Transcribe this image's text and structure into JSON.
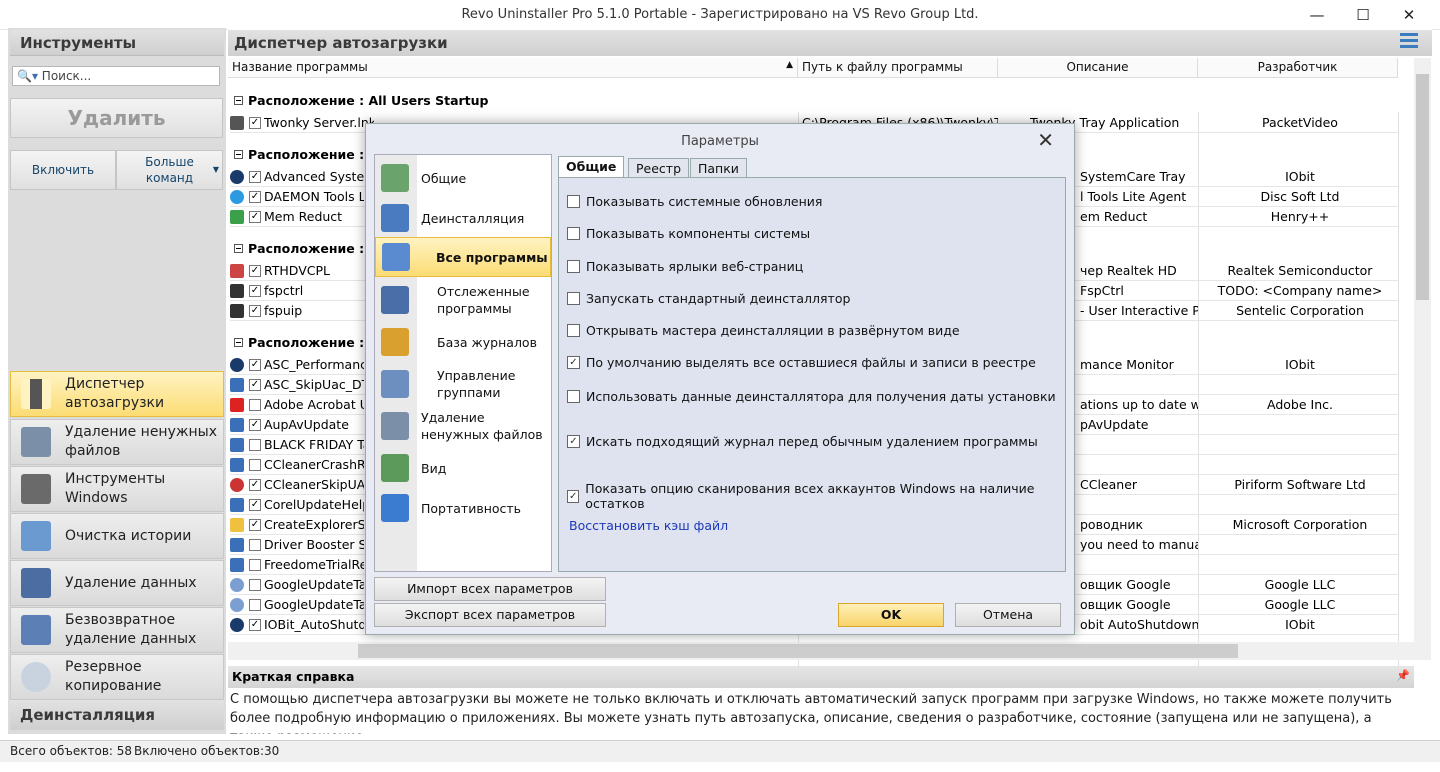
{
  "window": {
    "title": "Revo Uninstaller Pro 5.1.0 Portable - Зарегистрировано на VS Revo Group Ltd."
  },
  "left": {
    "header": "Инструменты",
    "search_placeholder": "Поиск...",
    "delete": "Удалить",
    "enable": "Включить",
    "more": "Больше команд",
    "tools": [
      "Диспетчер автозагрузки",
      "Удаление ненужных файлов",
      "Инструменты Windows",
      "Очистка истории",
      "Удаление данных",
      "Безвозвратное удаление данных",
      "Резервное копирование"
    ],
    "footer": "Деинсталляция"
  },
  "main": {
    "header": "Диспетчер автозагрузки",
    "columns": [
      "Название программы",
      "Путь к файлу программы",
      "Описание",
      "Разработчик"
    ],
    "groups": [
      "Расположение : All Users Startup",
      "Расположение : Re",
      "Расположение : Re",
      "Расположение : За"
    ],
    "group1_rows": [
      {
        "name": "Twonky Server.lnk",
        "path": "C:\\Program Files (x86)\\Twonky\\Tw",
        "desc": "Twonky Tray Application",
        "dev": "PacketVideo",
        "c": "✓"
      }
    ],
    "group2_rows": [
      {
        "name": "Advanced System",
        "desc": "SystemCare Tray",
        "dev": "IObit",
        "c": "✓"
      },
      {
        "name": "DAEMON Tools L",
        "desc": "l Tools Lite Agent",
        "dev": "Disc Soft Ltd",
        "c": "✓"
      },
      {
        "name": "Mem Reduct",
        "desc": "em Reduct",
        "dev": "Henry++",
        "c": "✓"
      }
    ],
    "group3_rows": [
      {
        "name": "RTHDVCPL",
        "desc": "чер Realtek HD",
        "dev": "Realtek Semiconductor",
        "c": "✓"
      },
      {
        "name": "fspctrl",
        "desc": "FspCtrl",
        "dev": "TODO: <Company name>",
        "c": "✓"
      },
      {
        "name": "fspuip",
        "desc": "- User Interactive Pr",
        "dev": "Sentelic Corporation",
        "c": "✓"
      }
    ],
    "group4_rows": [
      {
        "name": "ASC_Performance",
        "desc": "mance Monitor",
        "dev": "IObit",
        "c": "✓"
      },
      {
        "name": "ASC_SkipUac_DTo",
        "desc": "",
        "dev": "",
        "c": "✓"
      },
      {
        "name": "Adobe Acrobat U",
        "desc": "ations up to date with",
        "dev": "Adobe Inc.",
        "c": ""
      },
      {
        "name": "AupAvUpdate",
        "desc": "pAvUpdate",
        "dev": "",
        "c": "✓"
      },
      {
        "name": "BLACK FRIDAY Tas",
        "desc": "",
        "dev": "",
        "c": ""
      },
      {
        "name": "CCleanerCrashRe",
        "desc": "",
        "dev": "",
        "c": ""
      },
      {
        "name": "CCleanerSkipUAC",
        "desc": "CCleaner",
        "dev": "Piriform Software Ltd",
        "c": "✓"
      },
      {
        "name": "CorelUpdateHelp",
        "desc": "",
        "dev": "",
        "c": "✓"
      },
      {
        "name": "CreateExplorerSh",
        "desc": "роводник",
        "dev": "Microsoft Corporation",
        "c": "✓"
      },
      {
        "name": "Driver Booster Sk",
        "desc": "you need to manual",
        "dev": "",
        "c": ""
      },
      {
        "name": "FreedomeTrialRe",
        "desc": "",
        "dev": "",
        "c": ""
      },
      {
        "name": "GoogleUpdateTas",
        "desc": "овщик Google",
        "dev": "Google LLC",
        "c": ""
      },
      {
        "name": "GoogleUpdateTas",
        "desc": "овщик Google",
        "dev": "Google LLC",
        "c": ""
      },
      {
        "name": "IOBit_AutoShutdo",
        "desc": "obit AutoShutdown",
        "dev": "IObit",
        "c": "✓"
      }
    ]
  },
  "help": {
    "title": "Краткая справка",
    "text": "С помощью диспетчера автозагрузки вы можете не только включать и отключать автоматический запуск программ при загрузке Windows, но также можете получить более подробную информацию о приложениях. Вы можете узнать путь автозапуска, описание, сведения о разработчике, состояние (запущена или не запущена), а также размещение"
  },
  "status": {
    "total": "Всего объектов: 58",
    "enabled": "Включено объектов:30"
  },
  "dialog": {
    "title": "Параметры",
    "nav": [
      "Общие",
      "Деинсталляция",
      "Все программы",
      "Отслеженные программы",
      "База журналов",
      "Управление группами",
      "Удаление ненужных файлов",
      "Вид",
      "Портативность"
    ],
    "tabs": [
      "Общие",
      "Реестр",
      "Папки"
    ],
    "options": [
      {
        "label": "Показывать системные обновления",
        "c": ""
      },
      {
        "label": "Показывать компоненты системы",
        "c": ""
      },
      {
        "label": "Показывать ярлыки веб-страниц",
        "c": ""
      },
      {
        "label": "Запускать стандартный деинсталлятор",
        "c": ""
      },
      {
        "label": "Открывать мастера деинсталляции в развёрнутом виде",
        "c": ""
      },
      {
        "label": "По умолчанию выделять все оставшиеся файлы и записи в реестре",
        "c": "✓"
      },
      {
        "label": "Использовать данные деинсталлятора для получения даты установки",
        "c": ""
      },
      {
        "label": "Искать подходящий журнал перед обычным удалением программы",
        "c": "✓"
      },
      {
        "label": "Показать опцию сканирования всех аккаунтов Windows на наличие остатков",
        "c": "✓"
      }
    ],
    "link": "Восстановить кэш файл",
    "import": "Импорт всех параметров",
    "export": "Экспорт всех параметров",
    "ok": "OK",
    "cancel": "Отмена"
  }
}
